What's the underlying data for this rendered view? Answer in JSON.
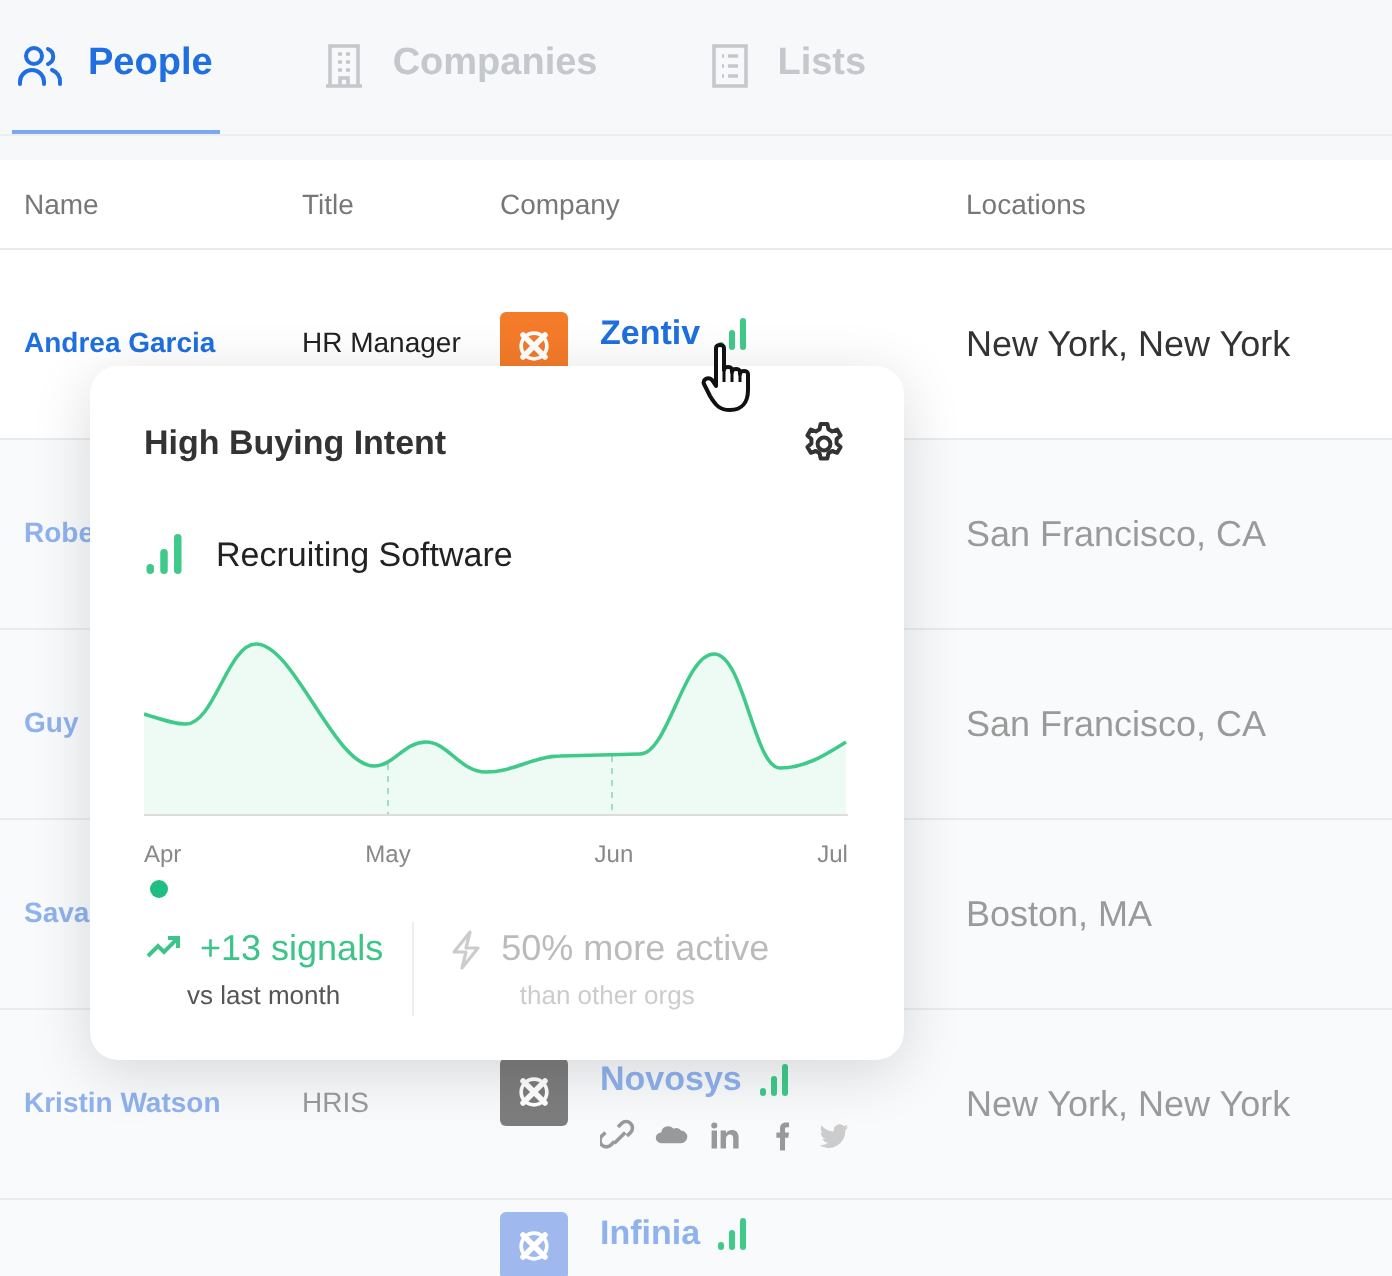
{
  "tabs": [
    {
      "label": "People",
      "kind": "people",
      "selected": true
    },
    {
      "label": "Companies",
      "kind": "companies",
      "selected": false
    },
    {
      "label": "Lists",
      "kind": "lists",
      "selected": false
    }
  ],
  "table": {
    "columns": [
      "Name",
      "Title",
      "Company",
      "Locations"
    ],
    "rows": [
      {
        "name": "Andrea Garcia",
        "title": "HR Manager",
        "company": "Zentiv",
        "location": "New York, New York",
        "highlighted": true,
        "color": "#f47b2a"
      },
      {
        "name": "Robe",
        "location": "San Francisco, CA",
        "highlighted": false
      },
      {
        "name": "Guy",
        "location": "San Francisco, CA",
        "highlighted": false
      },
      {
        "name": "Sava",
        "location": "Boston, MA",
        "highlighted": false
      },
      {
        "name": "Kristin Watson",
        "title": "HRIS",
        "company": "Novosys",
        "location": "New York, New York",
        "highlighted": false,
        "color": "#7d7d7d",
        "social_links": true
      },
      {
        "company": "Infinia",
        "highlighted": false,
        "color": "#9fb9ef"
      }
    ]
  },
  "popover": {
    "title": "High Buying Intent",
    "topic": "Recruiting Software",
    "x_labels": [
      "Apr",
      "May",
      "Jun",
      "Jul"
    ],
    "stats": [
      {
        "kind": "signals",
        "value": "+13 signals",
        "caption": "vs last month"
      },
      {
        "kind": "activity",
        "value": "50% more active",
        "caption": "than other orgs"
      }
    ]
  }
}
